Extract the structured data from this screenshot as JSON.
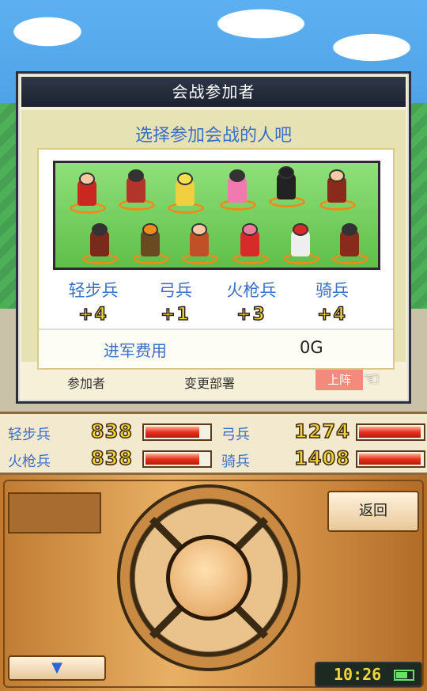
{
  "dialog": {
    "title": "会战参加者",
    "prompt": "选择参加会战的人吧",
    "troops": [
      {
        "name": "轻步兵",
        "count": "+4"
      },
      {
        "name": "弓兵",
        "count": "+1"
      },
      {
        "name": "火枪兵",
        "count": "+3"
      },
      {
        "name": "骑兵",
        "count": "+4"
      }
    ],
    "cost_label": "进军费用",
    "cost_value": "0G",
    "footer": {
      "participants": "参加者",
      "change_deploy": "变更部署",
      "deploy": "上阵"
    }
  },
  "stats": [
    {
      "name": "轻步兵",
      "value": "838",
      "fill": 0.85
    },
    {
      "name": "弓兵",
      "value": "1274",
      "fill": 0.98
    },
    {
      "name": "火枪兵",
      "value": "838",
      "fill": 0.85
    },
    {
      "name": "骑兵",
      "value": "1408",
      "fill": 0.98
    }
  ],
  "controls": {
    "back": "返回",
    "down_arrow": "▼"
  },
  "clock": {
    "time": "10:26"
  },
  "colors": {
    "accent_text": "#3a6fc6",
    "bar_fill": "#e8311f",
    "number_gold": "#f5d33a"
  }
}
